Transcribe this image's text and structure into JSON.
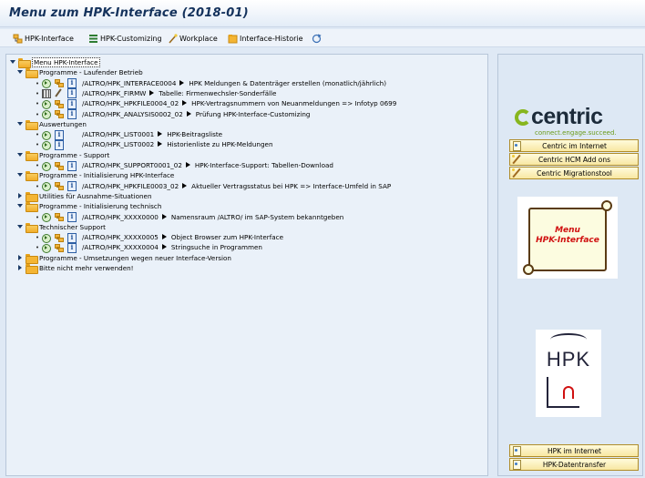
{
  "window": {
    "title": "Menu zum HPK-Interface (2018-01)"
  },
  "toolbar": {
    "items": [
      {
        "label": "HPK-Interface",
        "icon": "hierarchy-icon"
      },
      {
        "label": "HPK-Customizing",
        "icon": "customizing-icon"
      },
      {
        "label": "Workplace",
        "icon": "wand-icon"
      },
      {
        "label": "Interface-Historie",
        "icon": "history-icon"
      },
      {
        "label": "",
        "icon": "refresh-icon"
      }
    ]
  },
  "tree": {
    "root_label": "Menu HPK-Interface",
    "folders": [
      {
        "label": "Programme - Laufender Betrieb",
        "expanded": true,
        "rows": [
          {
            "code": "/ALTRO/HPK_INTERFACE0004",
            "desc": "HPK Meldungen & Datenträger erstellen (monatlich/jährlich)"
          },
          {
            "code": "/ALTRO/HPK_FIRMW",
            "desc": "Tabelle: Firmenwechsler-Sonderfälle"
          },
          {
            "code": "/ALTRO/HPK_HPKFILE0004_02",
            "desc": "HPK-Vertragsnummern von Neuanmeldungen => Infotyp 0699"
          },
          {
            "code": "/ALTRO/HPK_ANALYSIS0002_02",
            "desc": "Prüfung HPK-Interface-Customizing"
          }
        ]
      },
      {
        "label": "Auswertungen",
        "expanded": true,
        "rows": [
          {
            "code": "/ALTRO/HPK_LIST0001",
            "desc": "HPK-Beitragsliste"
          },
          {
            "code": "/ALTRO/HPK_LIST0002",
            "desc": "Historienliste zu HPK-Meldungen"
          }
        ]
      },
      {
        "label": "Programme - Support",
        "expanded": true,
        "rows": [
          {
            "code": "/ALTRO/HPK_SUPPORT0001_02",
            "desc": "HPK-Interface-Support: Tabellen-Download"
          }
        ]
      },
      {
        "label": "Programme - Initialisierung HPK-Interface",
        "expanded": true,
        "rows": [
          {
            "code": "/ALTRO/HPK_HPKFILE0003_02",
            "desc": "Aktueller Vertragsstatus bei HPK => Interface-Umfeld in SAP"
          }
        ]
      },
      {
        "label": "Utilities für Ausnahme-Situationen",
        "expanded": false,
        "rows": []
      },
      {
        "label": "Programme - Initialisierung technisch",
        "expanded": true,
        "rows": [
          {
            "code": "/ALTRO/HPK_XXXX0000",
            "desc": "Namensraum /ALTRO/ im SAP-System bekanntgeben"
          }
        ]
      },
      {
        "label": "Technischer Support",
        "expanded": true,
        "rows": [
          {
            "code": "/ALTRO/HPK_XXXX0005",
            "desc": "Object Browser zum HPK-Interface"
          },
          {
            "code": "/ALTRO/HPK_XXXX0004",
            "desc": "Stringsuche in Programmen"
          }
        ]
      },
      {
        "label": "Programme - Umsetzungen wegen neuer Interface-Version",
        "expanded": false,
        "rows": []
      },
      {
        "label": "Bitte nicht mehr verwenden!",
        "expanded": false,
        "rows": []
      }
    ]
  },
  "side": {
    "logo": {
      "word": "centric",
      "tagline": "connect.engage.succeed."
    },
    "buttons_top": [
      {
        "label": "Centric im Internet",
        "icon": "document-icon"
      },
      {
        "label": "Centric HCM Add ons",
        "icon": "wand-icon"
      },
      {
        "label": "Centric Migrationstool",
        "icon": "wand-icon"
      }
    ],
    "scroll_text_line1": "Menu",
    "scroll_text_line2": "HPK-Interface",
    "hpk_logo_text": "HPK",
    "buttons_bottom": [
      {
        "label": "HPK im Internet",
        "icon": "document-icon"
      },
      {
        "label": "HPK-Datentransfer",
        "icon": "document-icon"
      }
    ]
  }
}
